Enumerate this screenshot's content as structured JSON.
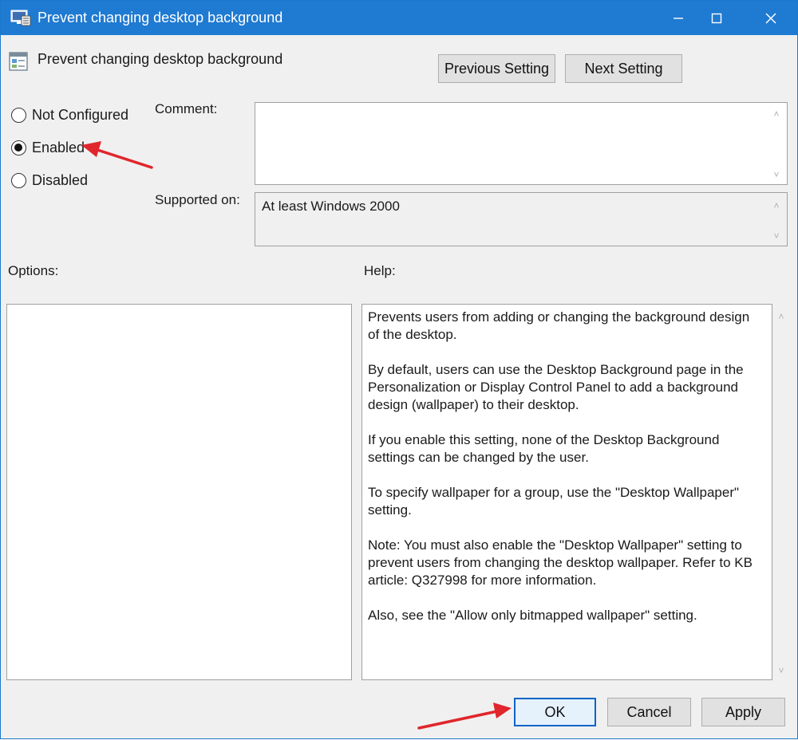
{
  "window": {
    "title": "Prevent changing desktop background",
    "controls": [
      "minimize",
      "maximize",
      "close"
    ]
  },
  "header": {
    "policy_name": "Prevent changing desktop background",
    "previous_button": "Previous Setting",
    "next_button": "Next Setting"
  },
  "state": {
    "options": [
      {
        "label": "Not Configured",
        "checked": false
      },
      {
        "label": "Enabled",
        "checked": true
      },
      {
        "label": "Disabled",
        "checked": false
      }
    ]
  },
  "comment": {
    "label": "Comment:",
    "value": ""
  },
  "supported": {
    "label": "Supported on:",
    "value": "At least Windows 2000"
  },
  "options_panel": {
    "label": "Options:"
  },
  "help_panel": {
    "label": "Help:",
    "paragraphs": [
      "Prevents users from adding or changing the background design of the desktop.",
      "By default, users can use the Desktop Background page in the Personalization or Display Control Panel to add a background design (wallpaper) to their desktop.",
      "If you enable this setting, none of the Desktop Background settings can be changed by the user.",
      "To specify wallpaper for a group, use the \"Desktop Wallpaper\" setting.",
      "Note: You must also enable the \"Desktop Wallpaper\" setting to prevent users from changing the desktop wallpaper. Refer to KB article: Q327998 for more information.",
      "Also, see the \"Allow only bitmapped wallpaper\" setting."
    ]
  },
  "footer": {
    "ok": "OK",
    "cancel": "Cancel",
    "apply": "Apply"
  },
  "colors": {
    "titlebar": "#1f7ad1",
    "annotation_arrow": "#e0262c",
    "ok_border": "#0a64c8"
  }
}
